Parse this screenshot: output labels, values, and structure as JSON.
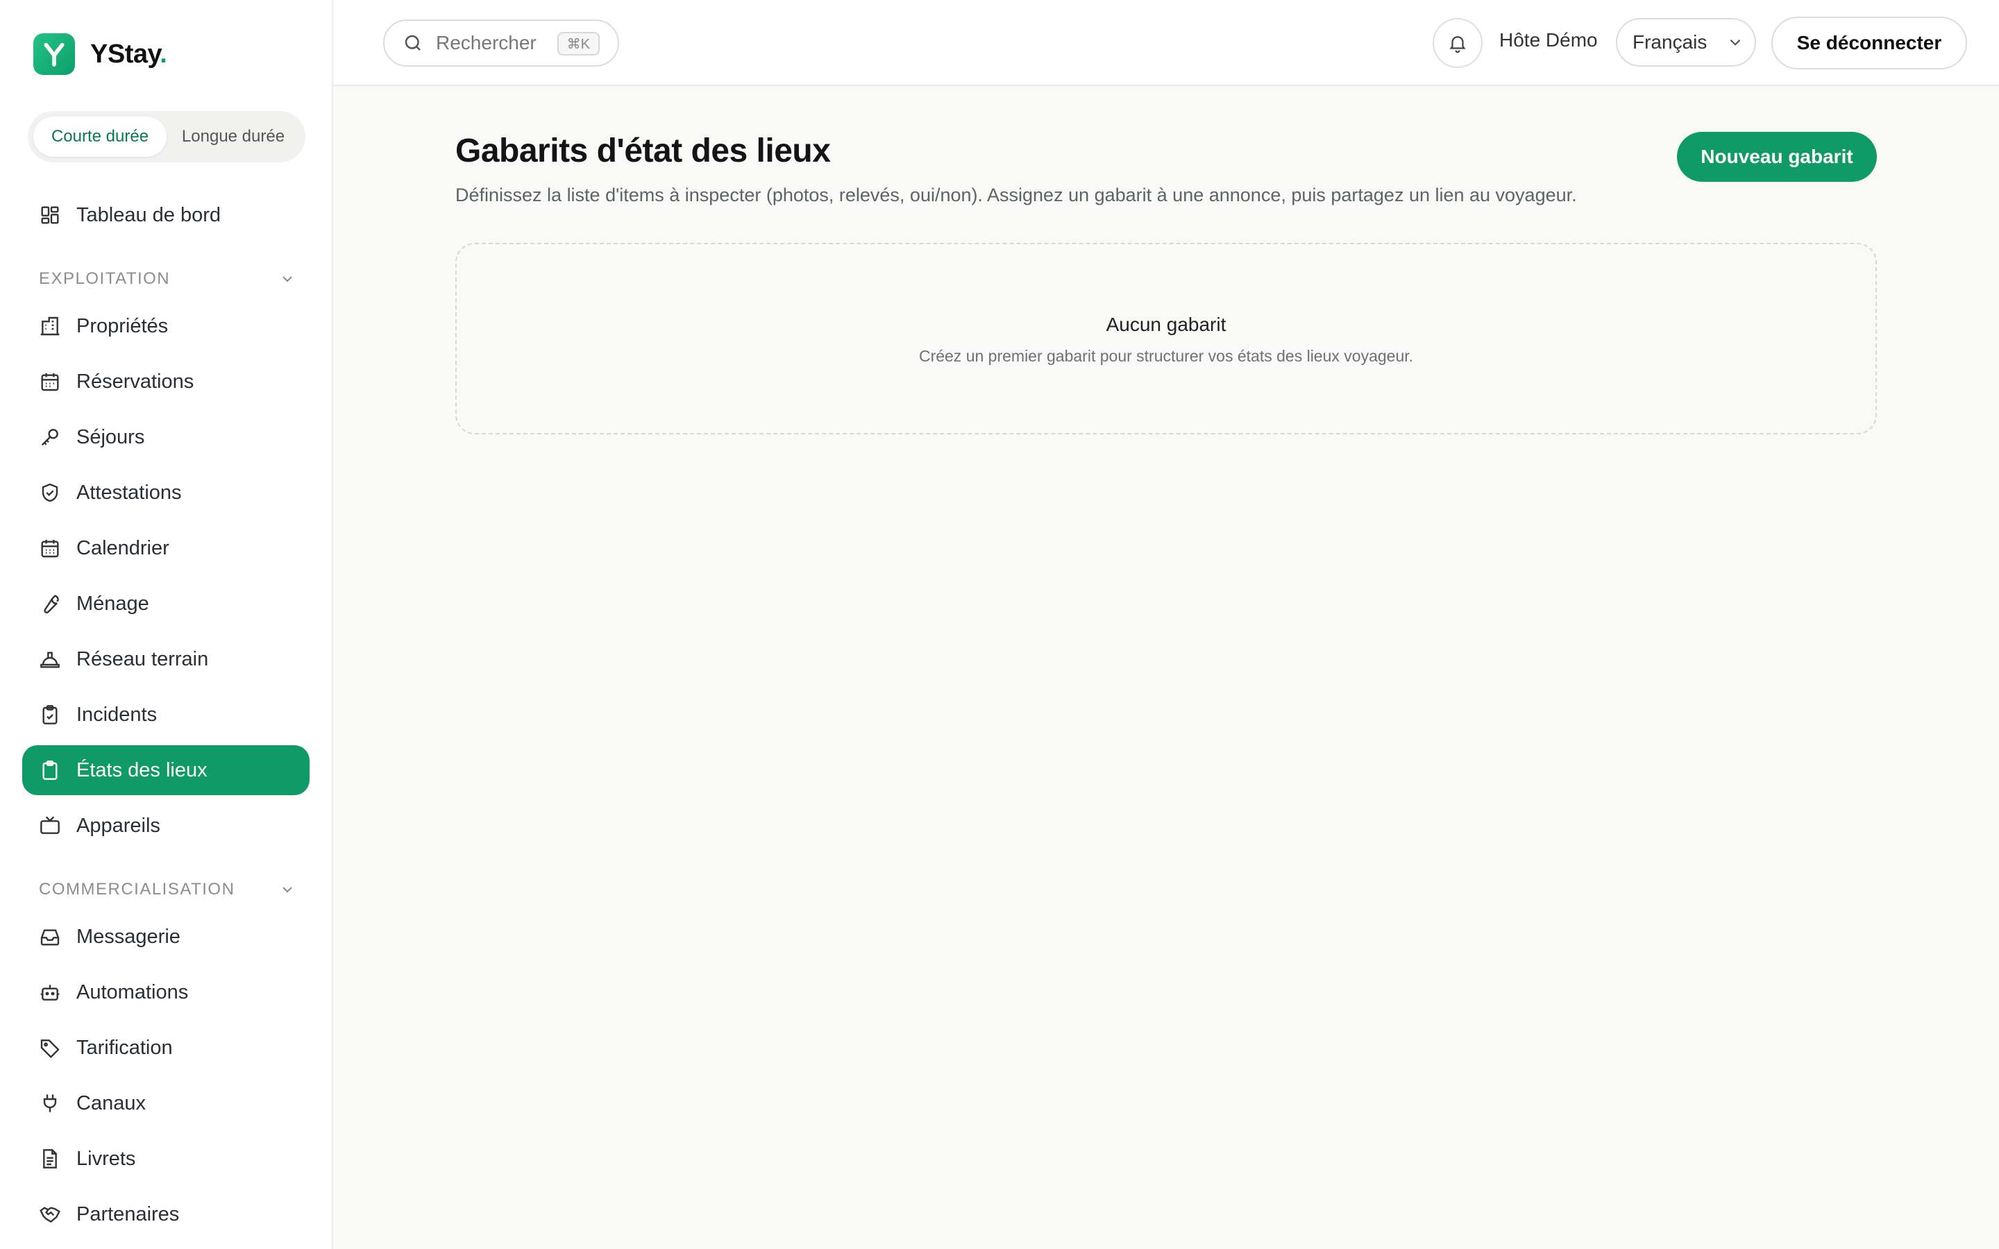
{
  "brand": {
    "name": "YStay",
    "dot": ".",
    "logo_letter": "Y",
    "accent": "#0f9a67"
  },
  "mode_toggle": [
    {
      "label": "Courte durée",
      "active": true
    },
    {
      "label": "Longue durée",
      "active": false
    }
  ],
  "sidebar": {
    "dashboard": {
      "label": "Tableau de bord",
      "icon": "dashboard-icon"
    },
    "sections": [
      {
        "title": "EXPLOITATION",
        "items": [
          {
            "label": "Propriétés",
            "icon": "building-icon"
          },
          {
            "label": "Réservations",
            "icon": "calendar-icon"
          },
          {
            "label": "Séjours",
            "icon": "key-icon"
          },
          {
            "label": "Attestations",
            "icon": "shield-check-icon"
          },
          {
            "label": "Calendrier",
            "icon": "calendar-icon"
          },
          {
            "label": "Ménage",
            "icon": "wrench-icon"
          },
          {
            "label": "Réseau terrain",
            "icon": "hard-hat-icon"
          },
          {
            "label": "Incidents",
            "icon": "clipboard-check-icon"
          },
          {
            "label": "États des lieux",
            "icon": "clipboard-icon",
            "active": true
          },
          {
            "label": "Appareils",
            "icon": "tv-icon"
          }
        ]
      },
      {
        "title": "COMMERCIALISATION",
        "items": [
          {
            "label": "Messagerie",
            "icon": "inbox-icon"
          },
          {
            "label": "Automations",
            "icon": "bot-icon"
          },
          {
            "label": "Tarification",
            "icon": "tag-icon"
          },
          {
            "label": "Canaux",
            "icon": "plug-icon"
          },
          {
            "label": "Livrets",
            "icon": "document-icon"
          },
          {
            "label": "Partenaires",
            "icon": "handshake-icon"
          }
        ]
      }
    ]
  },
  "topbar": {
    "search_placeholder": "Rechercher",
    "search_shortcut": "⌘K",
    "user_name": "Hôte Démo",
    "language": "Français",
    "logout_label": "Se déconnecter"
  },
  "main": {
    "title": "Gabarits d'état des lieux",
    "subtitle": "Définissez la liste d'items à inspecter (photos, relevés, oui/non). Assignez un gabarit à une annonce, puis partagez un lien au voyageur.",
    "new_button": "Nouveau gabarit",
    "empty_title": "Aucun gabarit",
    "empty_subtitle": "Créez un premier gabarit pour structurer vos états des lieux voyageur."
  }
}
